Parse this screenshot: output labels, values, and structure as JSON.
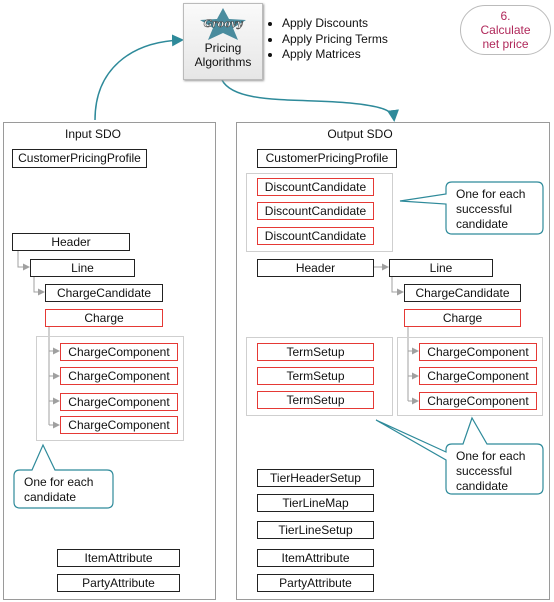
{
  "algorithms": {
    "label_line1": "Pricing",
    "label_line2": "Algorithms",
    "logo_text": "Groovy",
    "bullets": [
      "Apply Discounts",
      "Apply Pricing Terms",
      "Apply Matrices"
    ]
  },
  "step": {
    "number": "6.",
    "line1": "Calculate",
    "line2": "net price",
    "color": "#b0285a"
  },
  "input": {
    "title": "Input SDO",
    "customer_profile": "CustomerPricingProfile",
    "header": "Header",
    "line": "Line",
    "charge_candidate": "ChargeCandidate",
    "charge": "Charge",
    "charge_components": [
      "ChargeComponent",
      "ChargeComponent",
      "ChargeComponent",
      "ChargeComponent"
    ],
    "callout_line1": "One for each",
    "callout_line2": "candidate",
    "item_attribute": "ItemAttribute",
    "party_attribute": "PartyAttribute"
  },
  "output": {
    "title": "Output SDO",
    "customer_profile": "CustomerPricingProfile",
    "discount_candidates": [
      "DiscountCandidate",
      "DiscountCandidate",
      "DiscountCandidate"
    ],
    "callout1": [
      "One for each",
      "successful",
      "candidate"
    ],
    "header": "Header",
    "line": "Line",
    "charge_candidate": "ChargeCandidate",
    "charge": "Charge",
    "term_setups": [
      "TermSetup",
      "TermSetup",
      "TermSetup"
    ],
    "charge_components": [
      "ChargeComponent",
      "ChargeComponent",
      "ChargeComponent"
    ],
    "callout2": [
      "One for each",
      "successful",
      "candidate"
    ],
    "tier_header_setup": "TierHeaderSetup",
    "tier_line_map": "TierLineMap",
    "tier_line_setup": "TierLineSetup",
    "item_attribute": "ItemAttribute",
    "party_attribute": "PartyAttribute"
  },
  "colors": {
    "accent": "#2e8a9a",
    "required": "#e53935",
    "connector": "#a0a0a0"
  }
}
